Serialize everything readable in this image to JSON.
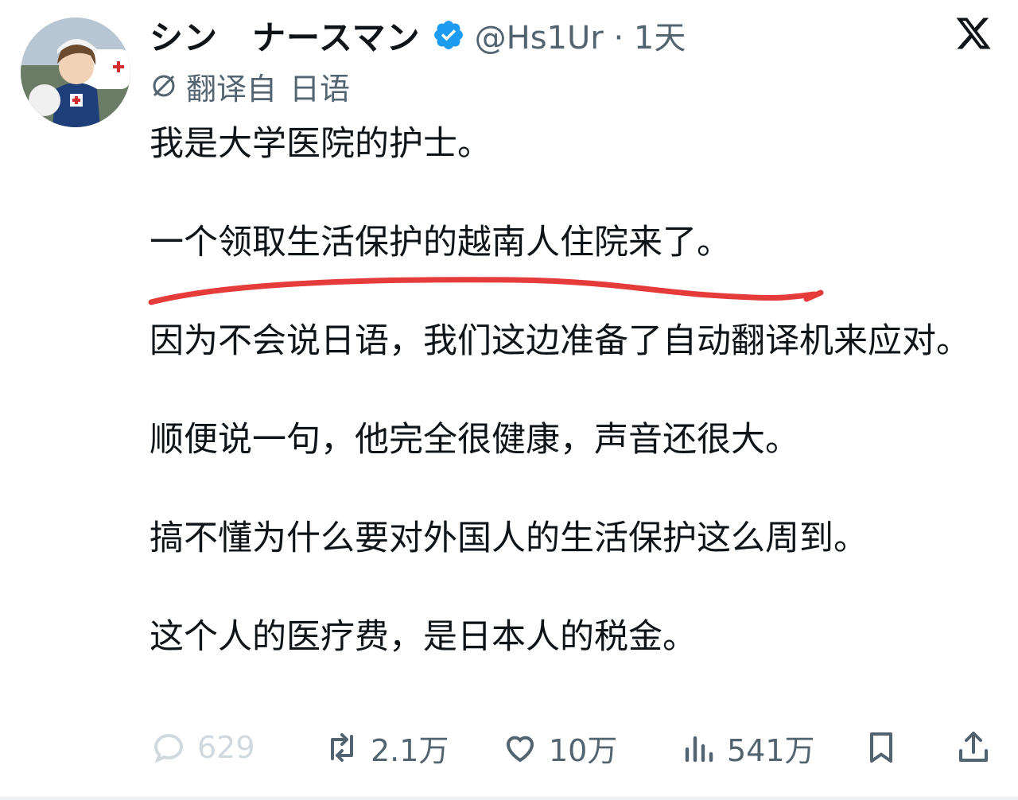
{
  "tweet": {
    "display_name": "シン　ナースマン",
    "handle_time": "@Hs1Ur · 1天",
    "translated_label": "翻译自",
    "translated_lang": "日语",
    "paragraphs": [
      "我是大学医院的护士。",
      "一个领取生活保护的越南人住院来了。",
      "因为不会说日语，我们这边准备了自动翻译机来应对。",
      "顺便说一句，他完全很健康，声音还很大。",
      "搞不懂为什么要对外国人的生活保护这么周到。",
      "这个人的医疗费，是日本人的税金。"
    ]
  },
  "actions": {
    "replies": "629",
    "reposts": "2.1万",
    "likes": "10万",
    "views": "541万"
  },
  "icons": [
    "verified-badge-icon",
    "x-logo-icon",
    "translate-globe-icon",
    "reply-icon",
    "repost-icon",
    "like-icon",
    "views-icon",
    "bookmark-icon",
    "share-icon"
  ],
  "colors": {
    "verified": "#1d9bf0",
    "underline_annotation": "#e63b3b",
    "muted_text": "#536471"
  }
}
